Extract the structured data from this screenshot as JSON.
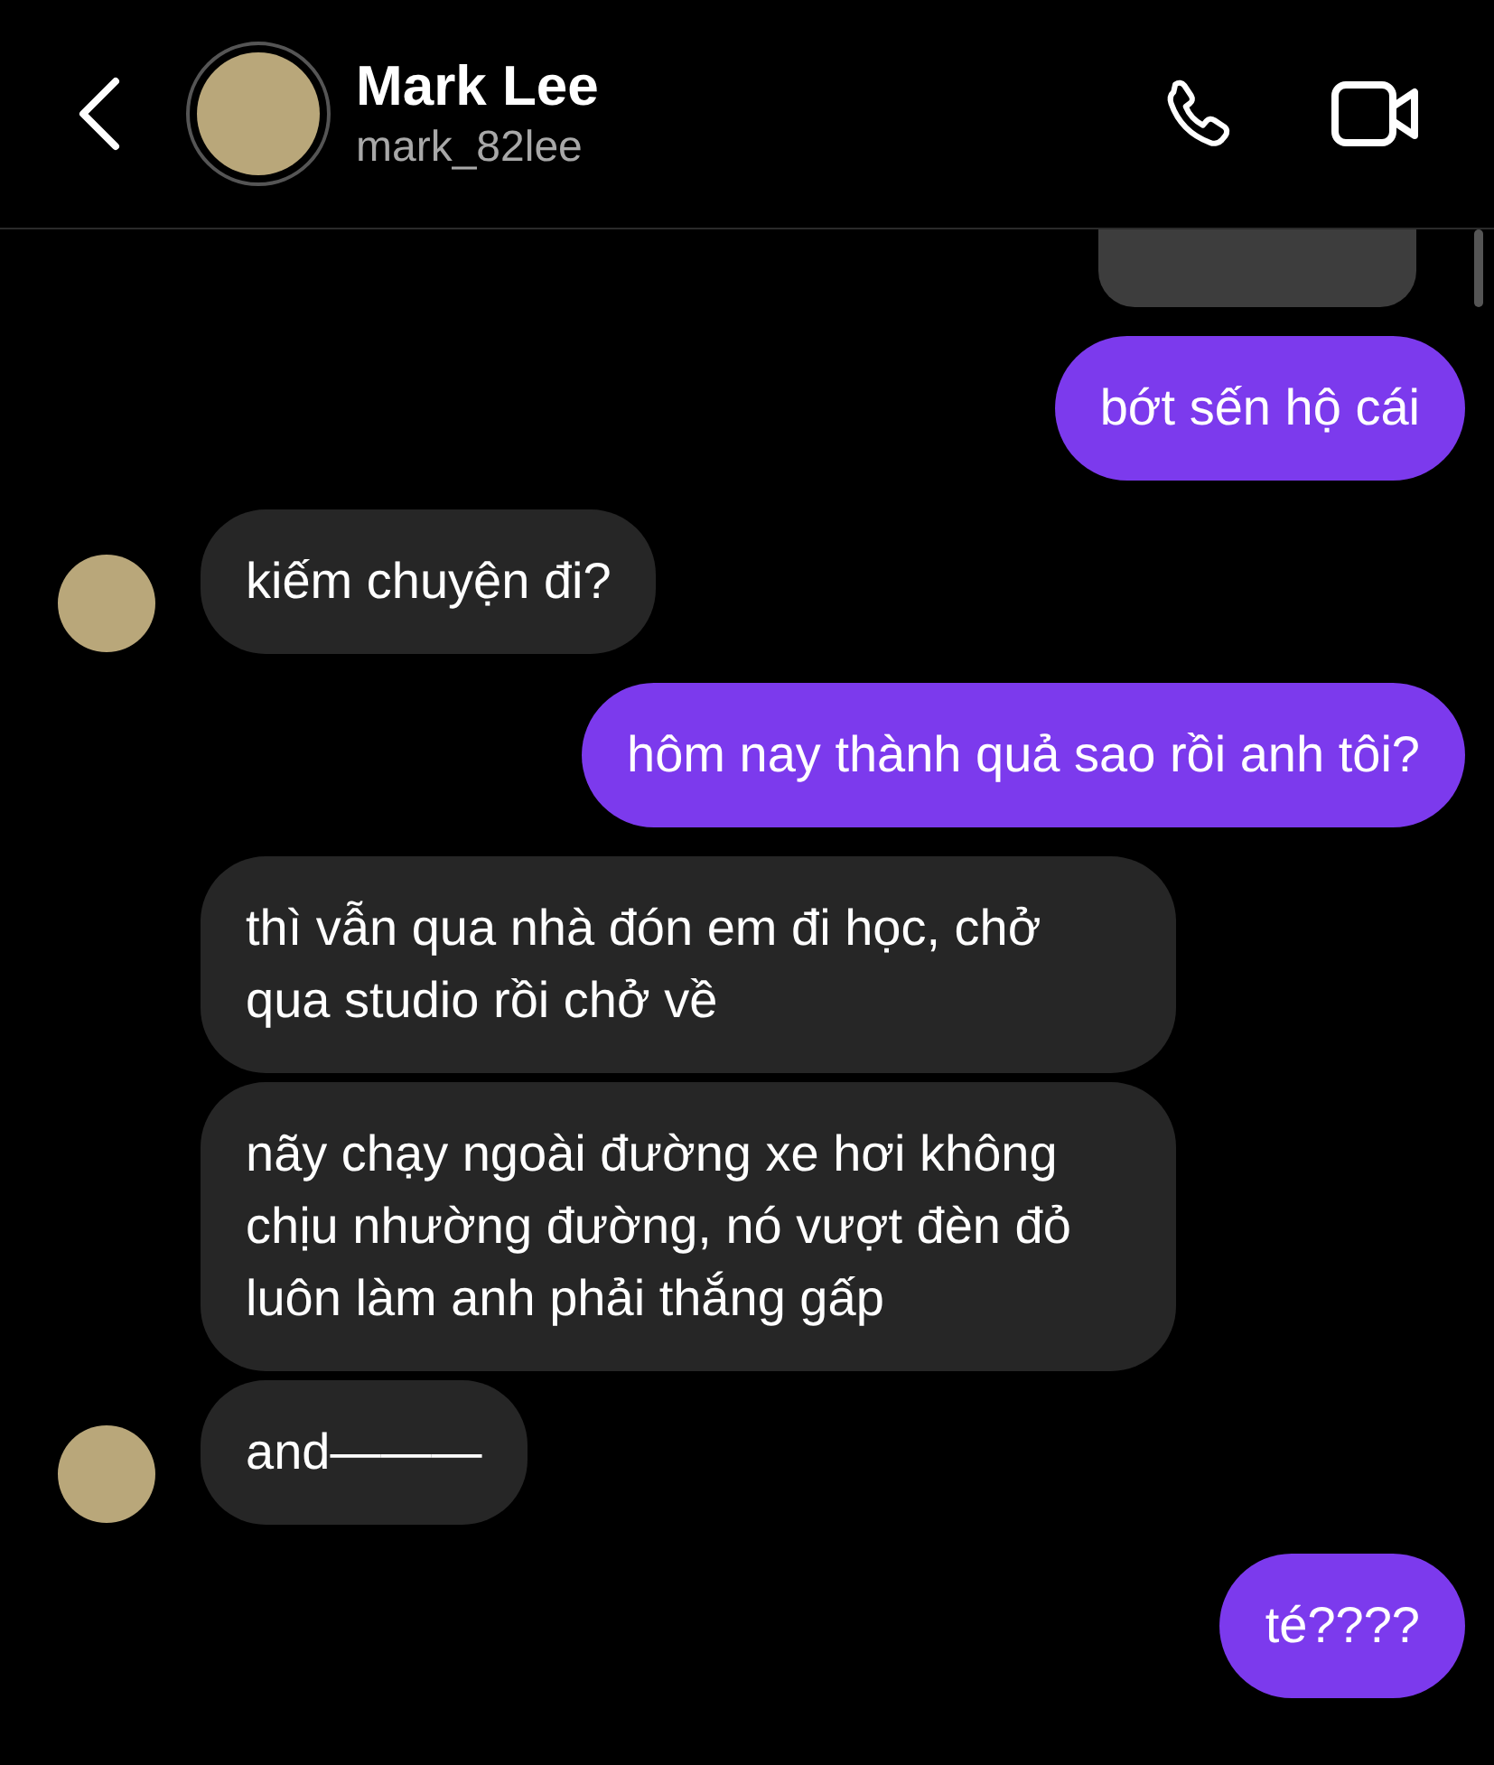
{
  "header": {
    "name": "Mark Lee",
    "username": "mark_82lee"
  },
  "messages": [
    {
      "kind": "sent",
      "text": "bớt sến hộ cái"
    },
    {
      "kind": "received",
      "text": "kiếm chuyện đi?",
      "avatar": true
    },
    {
      "kind": "sent",
      "text": "hôm nay thành quả sao rồi anh tôi?"
    },
    {
      "kind": "received",
      "text": "thì vẫn qua nhà đón em đi học, chở qua studio rồi chở về",
      "avatar": false
    },
    {
      "kind": "received",
      "text": "nãy chạy ngoài đường xe hơi không chịu nhường đường, nó vượt đèn đỏ luôn làm anh phải thắng gấp",
      "avatar": false
    },
    {
      "kind": "received",
      "text": "and———",
      "avatar": true
    },
    {
      "kind": "sent",
      "text": "té????"
    }
  ]
}
